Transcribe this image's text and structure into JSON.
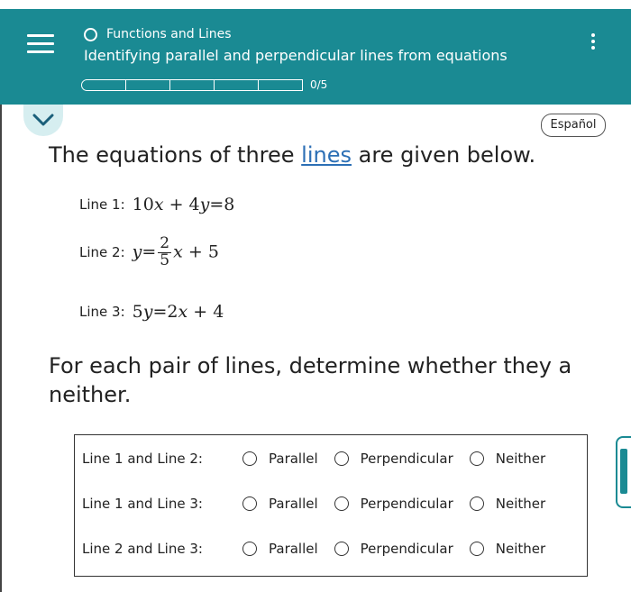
{
  "header": {
    "topic": "Functions and Lines",
    "subtitle": "Identifying parallel and perpendicular lines from equations",
    "progress_text": "0/5",
    "progress_fraction": 0,
    "progress_segments": 5,
    "background_color": "#1a8a93",
    "menu_icon": "hamburger-menu-icon",
    "more_icon": "kebab-menu-icon"
  },
  "toolbar": {
    "collapse_icon": "chevron-down-icon",
    "language_button": "Español"
  },
  "prompt": {
    "headline_before": "The equations of three ",
    "headline_link": "lines",
    "headline_after": " are given below.",
    "instruction_line1": "For each pair of lines, determine whether they a",
    "instruction_line2": "neither."
  },
  "equations": [
    {
      "label": "Line 1:",
      "equation": "10x + 4y = 8"
    },
    {
      "label": "Line 2:",
      "equation": "y = (2/5)x + 5"
    },
    {
      "label": "Line 3:",
      "equation": "5y = 2x + 4"
    }
  ],
  "math": {
    "l1": {
      "a": "10",
      "x": "x",
      "plus": "+",
      "b": "4",
      "y": "y",
      "eq": "=",
      "c": "8"
    },
    "l2": {
      "y": "y",
      "eq": "=",
      "num": "2",
      "den": "5",
      "x": "x",
      "plus": "+",
      "c": "5"
    },
    "l3": {
      "a": "5",
      "y": "y",
      "eq": "=",
      "b": "2",
      "x": "x",
      "plus": "+",
      "c": "4"
    }
  },
  "options": [
    "Parallel",
    "Perpendicular",
    "Neither"
  ],
  "questions": [
    {
      "label": "Line 1 and Line 2:",
      "selected": null
    },
    {
      "label": "Line 1 and Line 3:",
      "selected": null
    },
    {
      "label": "Line 2 and Line 3:",
      "selected": null
    }
  ]
}
